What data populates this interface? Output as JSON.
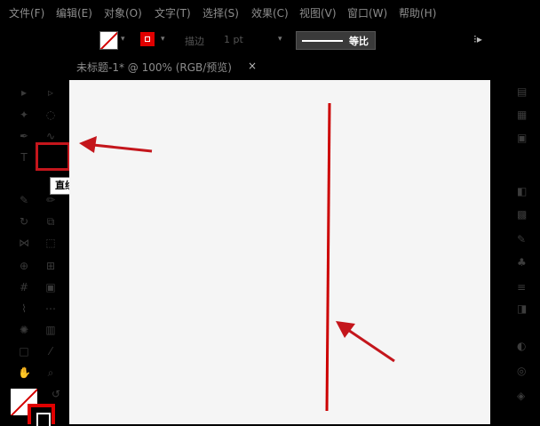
{
  "menu": [
    "文件(F)",
    "编辑(E)",
    "对象(O)",
    "文字(T)",
    "选择(S)",
    "效果(C)",
    "视图(V)",
    "窗口(W)",
    "帮助(H)"
  ],
  "control_bar": {
    "fill_icon": "none-swatch-icon",
    "stroke_icon": "stroke-swatch-icon",
    "stroke_label": "描边",
    "stroke_weight": "1 pt",
    "profile_label": "等比",
    "right_icon": "libraries-icon"
  },
  "document_tab": {
    "title": "未标题-1* @ 100% (RGB/预览)",
    "close": "×"
  },
  "tooltip": "直线段工具 (\\)",
  "colors": {
    "app_bg": "#000000",
    "artboard": "#f5f5f5",
    "accent_red": "#c4161c",
    "drawn_line": "#cc0000"
  }
}
